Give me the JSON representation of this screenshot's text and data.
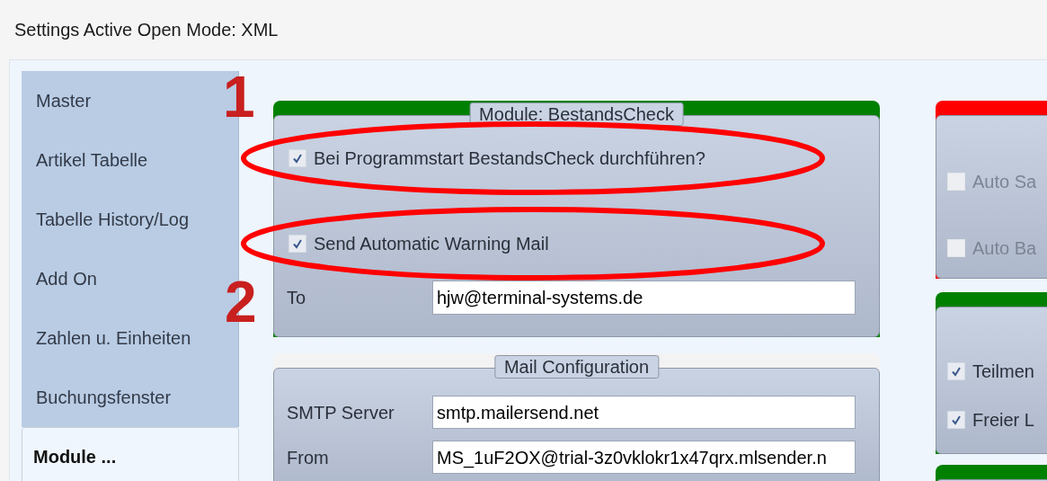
{
  "window": {
    "title": "Settings Active Open Mode: XML"
  },
  "sidebar": {
    "items": [
      {
        "label": "Master",
        "selected": false
      },
      {
        "label": "Artikel Tabelle",
        "selected": false
      },
      {
        "label": "Tabelle History/Log",
        "selected": false
      },
      {
        "label": "Add On",
        "selected": false
      },
      {
        "label": "Zahlen u. Einheiten",
        "selected": false
      },
      {
        "label": "Buchungsfenster",
        "selected": false
      },
      {
        "label": "Module ...",
        "selected": true
      }
    ]
  },
  "groups": [
    {
      "title": "Module: BestandsCheck",
      "color": "#008000",
      "items": [
        {
          "kind": "checkbox",
          "label": "Bei Programmstart BestandsCheck durchführen?",
          "checked": true
        },
        {
          "kind": "checkbox",
          "label": "Send Automatic Warning Mail",
          "checked": true
        },
        {
          "kind": "field",
          "label": "To",
          "value": "hjw@terminal-systems.de"
        }
      ]
    },
    {
      "title": "Mail Configuration",
      "items": [
        {
          "kind": "field",
          "label": "SMTP Server",
          "value": "smtp.mailersend.net"
        },
        {
          "kind": "field",
          "label": "From",
          "value": "MS_1uF2OX@trial-3z0vklokr1x47qrx.mlsender.n"
        }
      ]
    }
  ],
  "side_groups": [
    {
      "color": "#ff0000",
      "items": [
        {
          "kind": "checkbox",
          "label": "Auto Sa",
          "checked": false,
          "disabled": true
        },
        {
          "kind": "checkbox",
          "label": "Auto Ba",
          "checked": false,
          "disabled": true
        }
      ]
    },
    {
      "color": "#008000",
      "items": [
        {
          "kind": "checkbox",
          "label": "Teilmen",
          "checked": true,
          "disabled": false
        },
        {
          "kind": "checkbox",
          "label": "Freier L",
          "checked": true,
          "disabled": false
        }
      ]
    },
    {
      "color": "#008000"
    }
  ],
  "annotations": [
    {
      "kind": "label",
      "text": "1"
    },
    {
      "kind": "ellipse"
    },
    {
      "kind": "ellipse"
    },
    {
      "kind": "label",
      "text": "2"
    }
  ]
}
